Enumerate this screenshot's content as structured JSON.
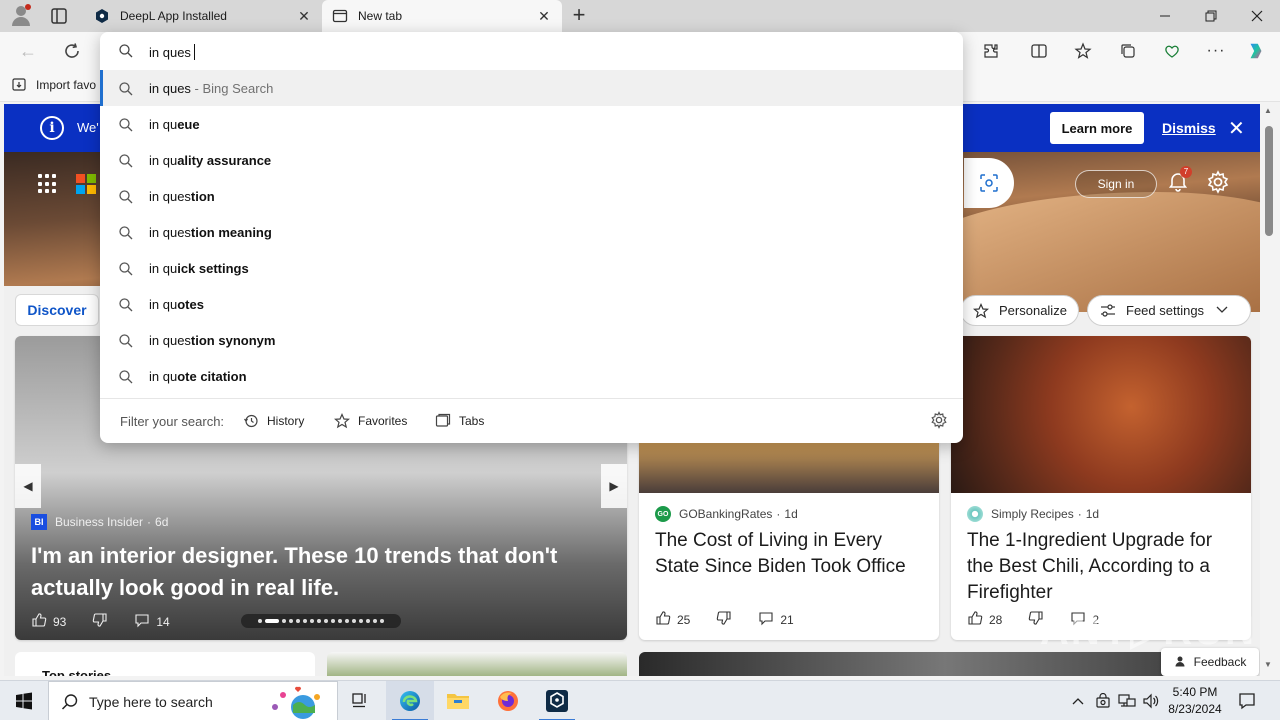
{
  "tabs": [
    {
      "title": "DeepL App Installed",
      "active": false
    },
    {
      "title": "New tab",
      "active": true
    }
  ],
  "address_bar": {
    "value": "in ques"
  },
  "suggestions": [
    {
      "typed": "in ques",
      "completion": "",
      "hint": " - Bing Search"
    },
    {
      "typed": "in qu",
      "completion": "eue",
      "hint": ""
    },
    {
      "typed": "in qu",
      "completion": "ality assurance",
      "hint": ""
    },
    {
      "typed": "in ques",
      "completion": "tion",
      "hint": ""
    },
    {
      "typed": "in ques",
      "completion": "tion meaning",
      "hint": ""
    },
    {
      "typed": "in qu",
      "completion": "ick settings",
      "hint": ""
    },
    {
      "typed": "in qu",
      "completion": "otes",
      "hint": ""
    },
    {
      "typed": "in ques",
      "completion": "tion synonym",
      "hint": ""
    },
    {
      "typed": "in qu",
      "completion": "ote citation",
      "hint": ""
    }
  ],
  "filter": {
    "label": "Filter your search:",
    "history": "History",
    "favorites": "Favorites",
    "tabs": "Tabs"
  },
  "favorites_bar": {
    "import_label": "Import favo"
  },
  "infobar": {
    "text": "We'",
    "learn_more": "Learn more",
    "dismiss": "Dismiss"
  },
  "header": {
    "sign_in": "Sign in",
    "notification_count": "7"
  },
  "feed": {
    "discover": "Discover",
    "personalize": "Personalize",
    "feed_settings": "Feed settings"
  },
  "cards": {
    "main": {
      "source": "Business Insider",
      "age": "6d",
      "headline": "I'm an interior designer. These 10 trends that don't actually look good in real life.",
      "likes": "93",
      "comments": "14"
    },
    "card2": {
      "source": "GOBankingRates",
      "age": "1d",
      "title": "The Cost of Living in Every State Since Biden Took Office",
      "likes": "25",
      "comments": "21"
    },
    "card3": {
      "source": "Simply Recipes",
      "age": "1d",
      "title": "The 1-Ingredient Upgrade for the Best Chili, According to a Firefighter",
      "likes": "28",
      "comments": "2"
    },
    "top_stories": "Top stories"
  },
  "feedback_label": "Feedback",
  "watermark": "ANY.RUN",
  "taskbar": {
    "search_placeholder": "Type here to search",
    "time": "5:40 PM",
    "date": "8/23/2024"
  },
  "colors": {
    "infobar": "#0a30c2",
    "accent": "#1f6fce",
    "discover_text": "#0f55c8"
  }
}
